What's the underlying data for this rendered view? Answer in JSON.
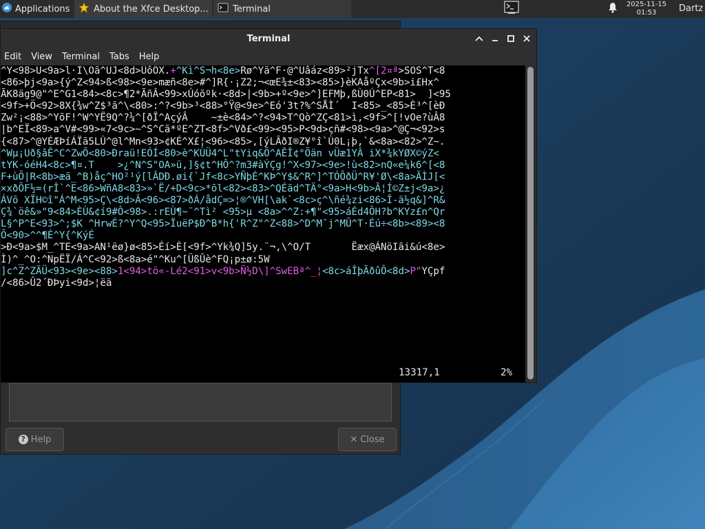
{
  "panel": {
    "applications_label": "Applications",
    "task_about_label": "About the Xfce Desktop...",
    "task_terminal_label": "Terminal",
    "clock_date": "2025-11-15",
    "clock_time": "01:53",
    "user_name": "Dartz"
  },
  "about_dialog": {
    "help_label": "Help",
    "close_label": "Close",
    "close_glyph": "✕"
  },
  "terminal": {
    "title": "Terminal",
    "menu": [
      "Edit",
      "View",
      "Terminal",
      "Tabs",
      "Help"
    ],
    "lines": [
      [
        [
          "w",
          "^Y<98>Ü<9a>l·Ì\\Oã^UJ<8d>ÛôÔX."
        ],
        [
          "m",
          "+"
        ],
        [
          "c",
          "^Kì^S¬h<8e>"
        ],
        [
          "w",
          "Rø^Yã^F·@^Uâáz<89>²jTx"
        ],
        [
          "m",
          "^[2¤ª"
        ],
        [
          "w",
          ">SOS^T<8"
        ]
      ],
      [
        [
          "w",
          "<86>þj<9a>{ý^Z<94>ß<98><9e>mæñ<8e>#^]R{·¡Z2;¬<œE¾±<83><85>}èKAåºÇx<9b>i£Hx^"
        ]
      ],
      [
        [
          "w",
          "ÃK8äg9@\"^E^G1<84><8c>¶2*ÃñÂ<99>xÚóõºk·<8d>|<9b>+º<9e>^]EFMþ,ßÙ0Ú^EP<81>  ]<95"
        ]
      ],
      [
        [
          "w",
          "<9f>+Ö<92>8X{¾w^Z$³ã^\\<80>:^?<9b>³<88>°Ÿ@<9e>^Eó'3t?%^SÅÌ´  I<85>_<85>È³^[èÐ"
        ]
      ],
      [
        [
          "w",
          "Zw²¡<88>^YõF!^W^YË9Q^?¼^[ðÏ^AçýÂ    ~±è<84>^?<94>T^Qò^ZÇ<81>ì,<9f>^[!vOe?ùÂ8"
        ]
      ],
      [
        [
          "w",
          "|b^EÏ<89>a^V#<99>«7<9c>~^S^Cã*ºE^ZT<8f>^Vð£<99><95>P<9d>çñ#<98><9a>^@Ç¬<92>s"
        ]
      ],
      [
        [
          "w",
          "{<87>^@YÉÆÞíÁÏã5LÙ^@l^Mn<93>¢KÉ^X£¦<96><85>,[ýLÂðI®Z¥°î`Ù0L¡þ,`&<8a><82>^Z~."
        ]
      ],
      [
        [
          "c",
          "^Wµ¡Uð§âÊ^C^ZwÕ<80>Ðraü!EÓÍ<80>è^KÙÜ4^L\"tYiq&Õ^AÊÎ¢°Õän vÜæ1YÂ iX*¾kYØX©ýZ<"
        ]
      ],
      [
        [
          "c",
          "tYK-óéH4<8c>¶¤.T    >¿^N^S\"OA»ü,]§¢t^HÔ^?m3#àÝÇg!^X<97><9e>!ù<82>nQ«e¼k6^[<8"
        ]
      ],
      [
        [
          "c",
          "F+ùÕ|R<8b>æã_^B)åç^HO²¹ý[lÂDÐ.øi{`Jf<8c>YÑþÉ^KÞ^Y$&^R^]^TÓÔðÜ^R¥'Ø\\<8a>ÃÌJ[<"
        ]
      ],
      [
        [
          "c",
          "×xðÕF½=(rÎ`^E<86>WñA8<83>»`Ë/+D<9c>*õl<82><83>^QÉãd^TÄ°<9a>H<9b>Ã¦Í©Z±j<9a>¿"
        ]
      ],
      [
        [
          "c",
          "ÁVõ XÏH©î\"Á^M<95>Ç\\<8d>Â<96><87>ðÁ/ådÇ=>¦®^VH[\\ak`<8c>ç^\\ñé¾zi<86>Î-ä½q&]^R&"
        ]
      ],
      [
        [
          "c",
          "Ç¾`öê&»\"9<84>ÈÙ&¢í9#Ô<98>.:rEÙ¶~¨^Tì² <95>µ <8a>^^Z:+¶\"<95>áÉd4ÕH?b^KYz£n^Qr"
        ]
      ],
      [
        [
          "c",
          "L§^P^E<93>^;$K ^HrwÉ?^Y^Q<95>ÏuëP$Ð^B*h{'R^Z\"^Z<88>^D^M¯j^MÛ^T·Éú÷<8b><89><8"
        ]
      ],
      [
        [
          "c",
          "Õ<90>^^¶É^Y{^KýÉ"
        ]
      ],
      [
        [
          "w",
          ">Ð<9a>$M_^TE<9a>AN¹ëø}ø<85>Éí>È[<9f>^Yk¾Q]5y.¨¬,\\^O/T       Ëæx@ÁNöIãi&ú<8e>"
        ]
      ],
      [
        [
          "w",
          "Ì)^_^O:^NpËÏ/Á^C<92>ß<8a>é\"^Ku^[ÜßÛè^FQ¡p±ø:5W"
        ]
      ],
      [
        [
          "c",
          "]c^Z^ZÄÜ<93><9e><88>"
        ],
        [
          "m",
          "1<94>tö«-Lé2<91>v<9b>Ñ½D\\]^SwEBª^_¦"
        ],
        [
          "c",
          "<8c>áÎþÃðûÔ<8d>"
        ],
        [
          "m",
          "P\""
        ],
        [
          "w",
          "YÇpf"
        ]
      ],
      [
        [
          "w",
          "/<86>Û2´ÐÞyi<9d>¦ëä"
        ]
      ]
    ],
    "status_position": "13317,1",
    "status_percent": "2%"
  }
}
